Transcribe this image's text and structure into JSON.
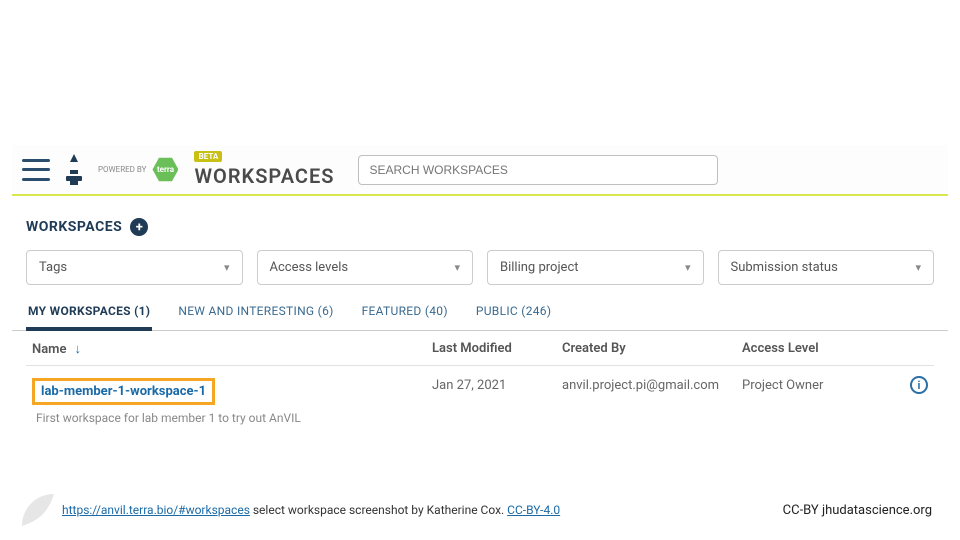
{
  "header": {
    "powered_by": "POWERED BY",
    "terra_label": "terra",
    "beta": "BETA",
    "title": "WORKSPACES",
    "search_placeholder": "SEARCH WORKSPACES"
  },
  "section": {
    "title": "WORKSPACES"
  },
  "filters": [
    {
      "label": "Tags"
    },
    {
      "label": "Access levels"
    },
    {
      "label": "Billing project"
    },
    {
      "label": "Submission status"
    }
  ],
  "tabs": [
    {
      "label": "MY WORKSPACES (1)",
      "active": true
    },
    {
      "label": "NEW AND INTERESTING (6)",
      "active": false
    },
    {
      "label": "FEATURED (40)",
      "active": false
    },
    {
      "label": "PUBLIC (246)",
      "active": false
    }
  ],
  "table": {
    "columns": {
      "name": "Name",
      "last_modified": "Last Modified",
      "created_by": "Created By",
      "access_level": "Access Level"
    },
    "rows": [
      {
        "name": "lab-member-1-workspace-1",
        "description": "First workspace for lab member 1 to try out AnVIL",
        "last_modified": "Jan 27, 2021",
        "created_by": "anvil.project.pi@gmail.com",
        "access_level": "Project Owner"
      }
    ]
  },
  "footer": {
    "url": "https://anvil.terra.bio/#workspaces",
    "caption_mid": " select  workspace screenshot by Katherine Cox.  ",
    "license_link": "CC-BY-4.0",
    "right": "CC-BY  jhudatascience.org"
  }
}
